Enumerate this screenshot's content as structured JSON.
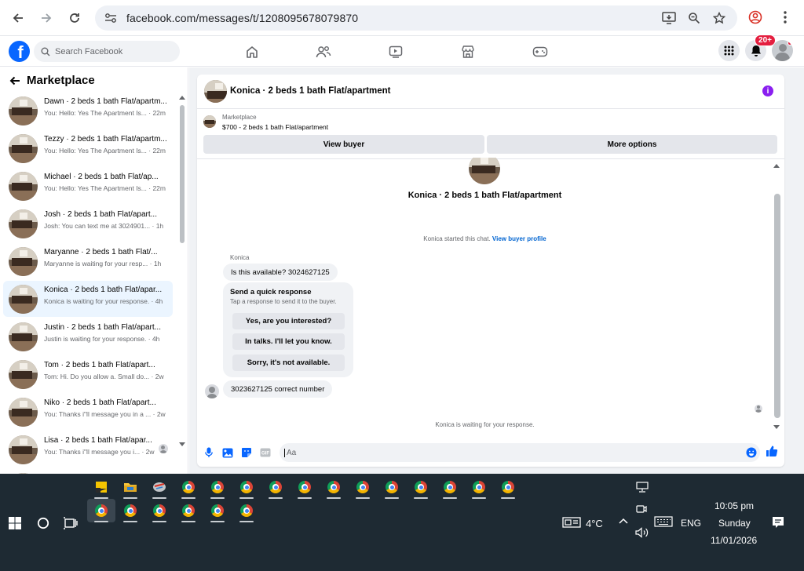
{
  "browser": {
    "url": "facebook.com/messages/t/1208095678079870"
  },
  "fb": {
    "search_placeholder": "Search Facebook",
    "logo_letter": "f",
    "notification_badge": "20+"
  },
  "sidebar": {
    "title": "Marketplace",
    "conversations": [
      {
        "name": "Dawn · 2 beds 1 bath Flat/apartm...",
        "preview": "You: Hello: Yes The Apartment Is... · 22m"
      },
      {
        "name": "Tezzy · 2 beds 1 bath Flat/apartm...",
        "preview": "You: Hello: Yes The Apartment Is... · 22m"
      },
      {
        "name": "Michael · 2 beds 1 bath Flat/ap...",
        "preview": "You: Hello: Yes The Apartment Is... · 22m"
      },
      {
        "name": "Josh · 2 beds 1 bath Flat/apart...",
        "preview": "Josh: You can text me at 3024901... · 1h"
      },
      {
        "name": "Maryanne · 2 beds 1 bath Flat/...",
        "preview": "Maryanne is waiting for your resp... · 1h"
      },
      {
        "name": "Konica · 2 beds 1 bath Flat/apar...",
        "preview": "Konica is waiting for your response. · 4h"
      },
      {
        "name": "Justin · 2 beds 1 bath Flat/apart...",
        "preview": "Justin is waiting for your response. · 4h"
      },
      {
        "name": "Tom · 2 beds 1 bath Flat/apart...",
        "preview": "Tom: Hi. Do you allow a. Small do... · 2w"
      },
      {
        "name": "Niko · 2 beds 1 bath Flat/apart...",
        "preview": "You: Thanks i\"ll message you in a ... · 2w"
      },
      {
        "name": "Lisa · 2 beds 1 bath Flat/apar...",
        "preview": "You: Thanks i\"ll message you i... · 2w"
      }
    ]
  },
  "chat": {
    "header_title": "Konica · 2 beds 1 bath Flat/apartment",
    "marketplace_label": "Marketplace",
    "listing_price": "$700 - 2 beds 1 bath Flat/apartment",
    "view_buyer": "View buyer",
    "more_options": "More options",
    "center_title": "Konica · 2 beds 1 bath Flat/apartment",
    "started_text": "Konica started this chat.",
    "view_buyer_profile": "View buyer profile",
    "sender_name": "Konica",
    "msg1": "Is this available? 3024627125",
    "quick_title": "Send a quick response",
    "quick_sub": "Tap a response to send it to the buyer.",
    "quick_replies": [
      "Yes, are you interested?",
      "In talks. I'll let you know.",
      "Sorry, it's not available."
    ],
    "msg2": "3023627125 correct number",
    "waiting": "Konica is waiting for your response.",
    "composer_placeholder": "Aa"
  },
  "taskbar": {
    "weather": "4°C",
    "language": "ENG",
    "time": "10:05 pm",
    "day": "Sunday",
    "date": "11/01/2026"
  }
}
